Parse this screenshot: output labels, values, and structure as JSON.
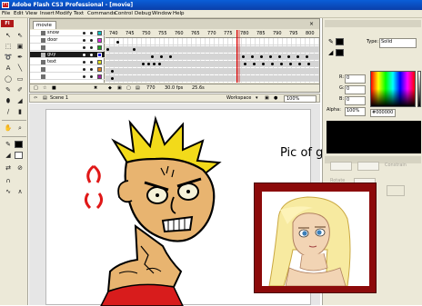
{
  "window": {
    "title": "Adobe Flash CS3 Professional - [movie]",
    "app_icon_text": "Fl"
  },
  "menu": [
    "File",
    "Edit",
    "View",
    "Insert",
    "Modify",
    "Text",
    "Commands",
    "Control",
    "Debug",
    "Window",
    "Help"
  ],
  "tools_panel": {
    "logo": "Fl"
  },
  "timeline": {
    "tab": "movie",
    "layers": [
      "snow",
      "door",
      "",
      "guy",
      "text",
      "",
      ""
    ],
    "ruler_ticks": [
      "740",
      "745",
      "750",
      "755",
      "760",
      "765",
      "770",
      "775",
      "780",
      "785",
      "790",
      "795",
      "800"
    ],
    "current_frame": "770",
    "frame_rate": "30.0 fps",
    "elapsed": "25.6s"
  },
  "scene_bar": {
    "scene": "Scene 1",
    "workspace": "Workspace",
    "zoom": "100%"
  },
  "color_panel": {
    "type_label": "Type:",
    "type_value": "Solid",
    "r_label": "R:",
    "r_value": "0",
    "g_label": "G:",
    "g_value": "0",
    "b_label": "B:",
    "b_value": "0",
    "alpha_label": "Alpha:",
    "alpha_value": "100%",
    "hex_value": "#000000",
    "swatch_color": "#000000"
  },
  "properties_panel": {
    "constrain_label": "Constrain",
    "rotate_label": "Rotate"
  },
  "overlay": {
    "caption": "Pic of girl!!!!!"
  },
  "colors": {
    "titlebar": "#0a5ed8",
    "frame": "#8c0a0a",
    "panel": "#ece9d8",
    "hair": "#f2da1a",
    "skin": "#e8b470",
    "shirt": "#d81c1c"
  }
}
